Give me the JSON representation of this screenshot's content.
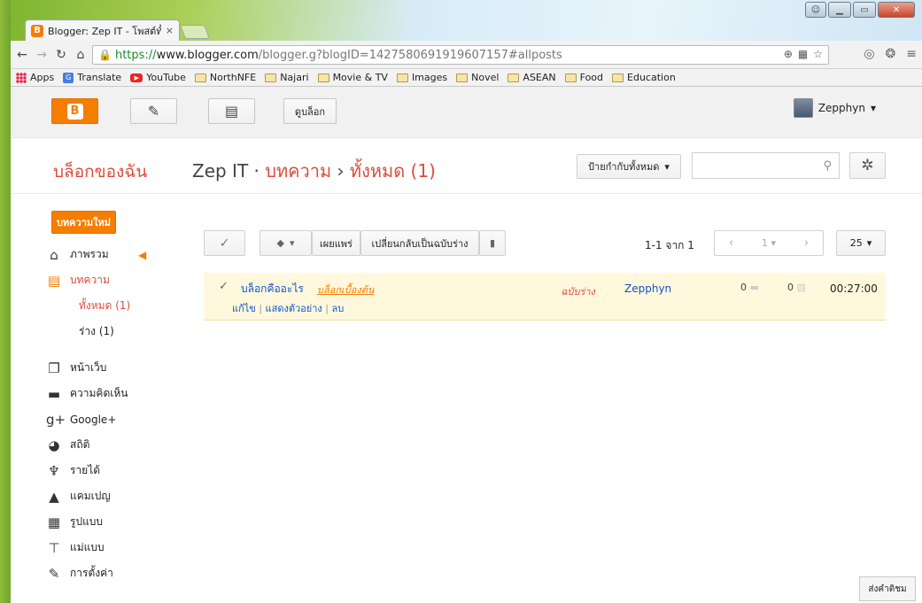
{
  "browser": {
    "tab_title": "Blogger: Zep IT - โพสต์ทั้งห",
    "tab_close": "×",
    "url_https": "https://",
    "url_host": "www.blogger.com",
    "url_path": "/blogger.g?blogID=1427580691919607157#allposts",
    "bookmarks": [
      "Apps",
      "Translate",
      "YouTube",
      "NorthNFE",
      "Najari",
      "Movie & TV",
      "Images",
      "Novel",
      "ASEAN",
      "Food",
      "Education"
    ]
  },
  "topbar": {
    "view_blog": "ดูบล็อก",
    "account_name": "Zepphyn"
  },
  "header": {
    "my_blogs": "บล็อกของฉัน",
    "blog_name": "Zep IT",
    "dot": " · ",
    "posts_link": "บทความ",
    "arrow": " › ",
    "all_count": "ทั้งหมด (1)",
    "labels_dropdown": "ป้ายกำกับทั้งหมด"
  },
  "sidebar": {
    "new_post": "บทความใหม่",
    "items": [
      {
        "label": "ภาพรวม",
        "icon": "home-icon"
      },
      {
        "label": "บทความ",
        "icon": "posts-icon"
      },
      {
        "label": "หน้าเว็บ",
        "icon": "pages-icon"
      },
      {
        "label": "ความคิดเห็น",
        "icon": "comments-icon"
      },
      {
        "label": "Google+",
        "icon": "google-plus-icon"
      },
      {
        "label": "สถิติ",
        "icon": "stats-icon"
      },
      {
        "label": "รายได้",
        "icon": "earnings-icon"
      },
      {
        "label": "แคมเปญ",
        "icon": "campaigns-icon"
      },
      {
        "label": "รูปแบบ",
        "icon": "layout-icon"
      },
      {
        "label": "แม่แบบ",
        "icon": "template-icon"
      },
      {
        "label": "การตั้งค่า",
        "icon": "settings-icon"
      }
    ],
    "sub_items": [
      "ทั้งหมด (1)",
      "ร่าง (1)"
    ]
  },
  "actions": {
    "publish": "เผยแพร่",
    "revert": "เปลี่ยนกลับเป็นฉบับร่าง",
    "pager_text": "1-1 จาก 1",
    "page_num": "1",
    "per_page": "25"
  },
  "posts": [
    {
      "title": "บล็อกคืออะไร",
      "label": "บล็อกเบื้องต้น",
      "edit": "แก้ไข",
      "preview": "แสดงตัวอย่าง",
      "delete": "ลบ",
      "status": "ฉบับร่าง",
      "author": "Zepphyn",
      "comments": "0",
      "views": "0",
      "time": "00:27:00"
    }
  ],
  "feedback": "ส่งคำติชม",
  "colors": {
    "accent": "#f57d00",
    "link": "#1155cc",
    "red": "#dd4b39",
    "row_bg": "#fff8dd"
  }
}
